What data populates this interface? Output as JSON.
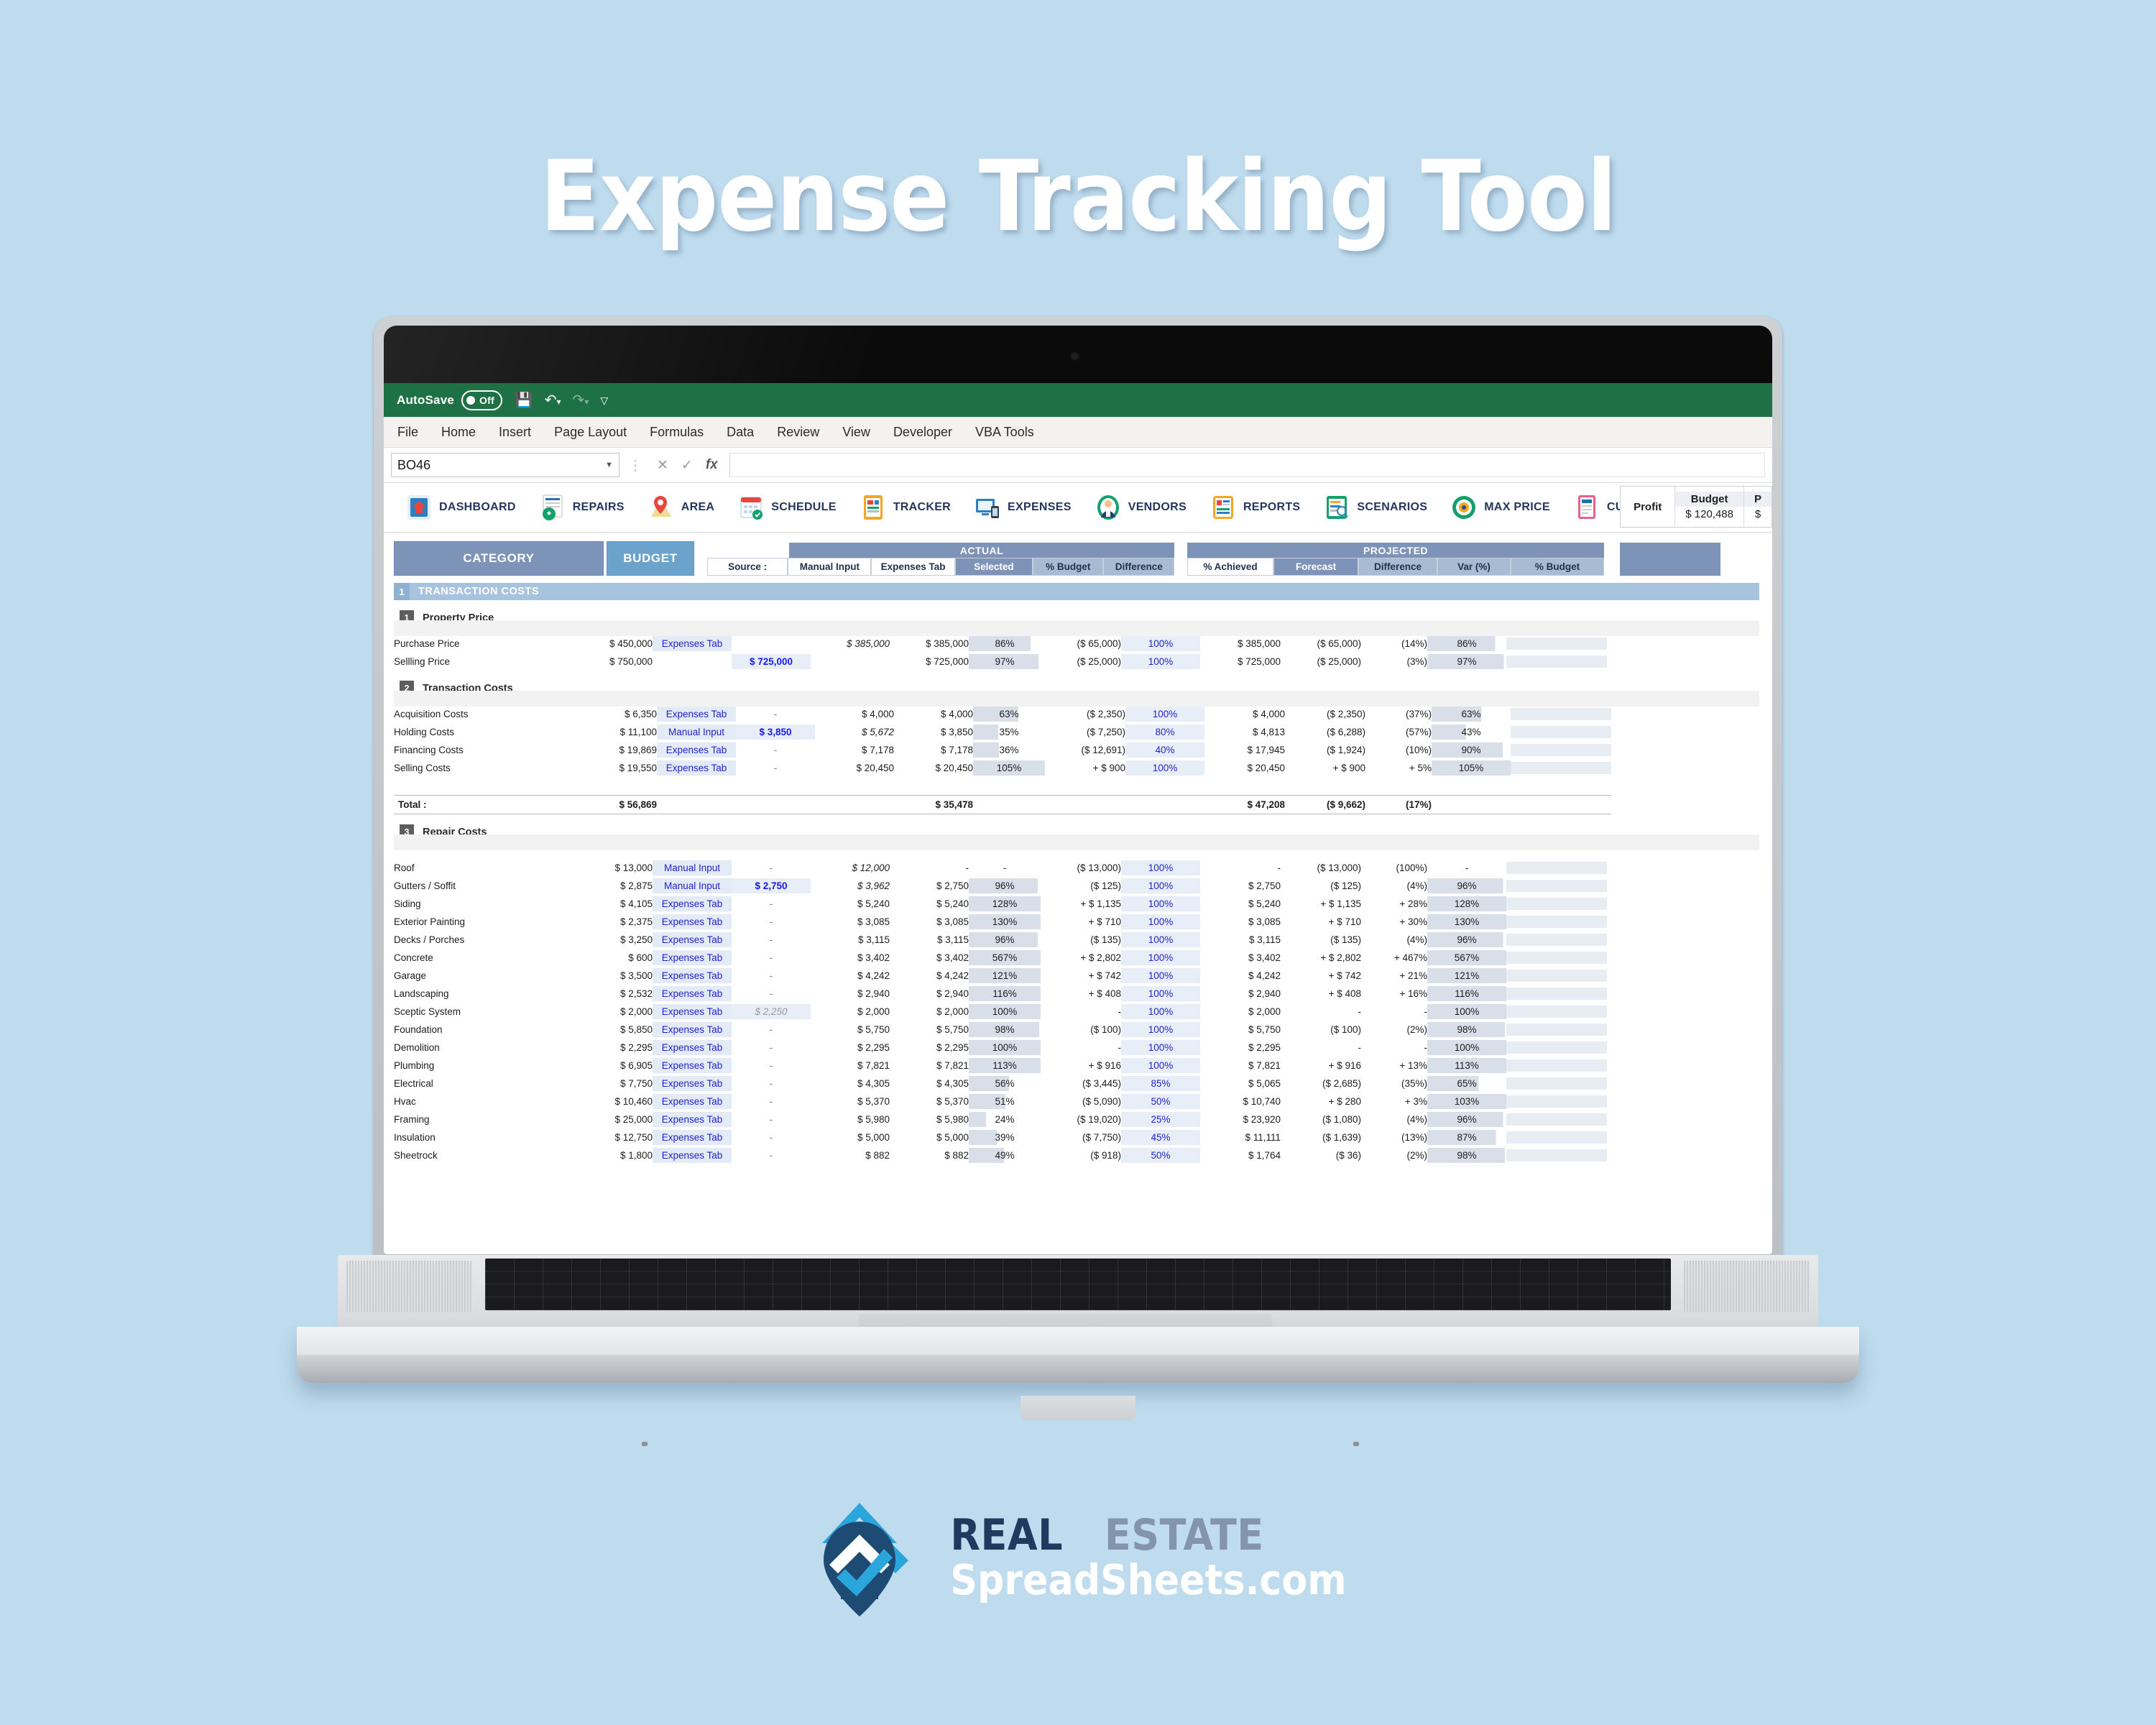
{
  "hero": {
    "title": "Expense Tracking Tool"
  },
  "excel": {
    "autosave_label": "AutoSave",
    "autosave_state": "Off",
    "quick_access": [
      "save-icon",
      "undo-icon",
      "redo-icon",
      "customize-qat-icon"
    ],
    "menu": [
      "File",
      "Home",
      "Insert",
      "Page Layout",
      "Formulas",
      "Data",
      "Review",
      "View",
      "Developer",
      "VBA Tools"
    ],
    "name_box": "BO46",
    "formula_bar": "",
    "formula_buttons": [
      "cancel-icon",
      "enter-icon",
      "insert-function-icon"
    ]
  },
  "nav": {
    "items": [
      {
        "label": "DASHBOARD",
        "icon": "dashboard-icon"
      },
      {
        "label": "REPAIRS",
        "icon": "repairs-icon"
      },
      {
        "label": "AREA",
        "icon": "area-pin-icon"
      },
      {
        "label": "SCHEDULE",
        "icon": "schedule-calendar-icon"
      },
      {
        "label": "TRACKER",
        "icon": "tracker-icon"
      },
      {
        "label": "EXPENSES",
        "icon": "expenses-icon"
      },
      {
        "label": "VENDORS",
        "icon": "vendors-icon"
      },
      {
        "label": "REPORTS",
        "icon": "reports-icon"
      },
      {
        "label": "SCENARIOS",
        "icon": "scenarios-icon"
      },
      {
        "label": "MAX PRICE",
        "icon": "max-price-icon"
      },
      {
        "label": "CUSTOM",
        "icon": "custom-icon"
      }
    ],
    "profit_box": {
      "profit_label": "Profit",
      "budget_label": "Budget",
      "budget_value": "$ 120,488",
      "next_label": "P"
    }
  },
  "table": {
    "col_category": "CATEGORY",
    "col_budget": "BUDGET",
    "group_actual": "ACTUAL",
    "group_projected": "PROJECTED",
    "actual_cols": [
      "Source :",
      "Manual Input",
      "Expenses Tab",
      "Selected",
      "% Budget",
      "Difference"
    ],
    "projected_cols": [
      "% Achieved",
      "Forecast",
      "Difference",
      "Var (%)",
      "% Budget"
    ],
    "band": {
      "num": "1",
      "title": "TRANSACTION COSTS"
    },
    "sections": [
      {
        "num": "1",
        "title": "Property Price",
        "rows": [
          {
            "name": "Purchase Price",
            "budget": "$ 450,000",
            "source": "Expenses Tab",
            "manual": "",
            "expenses": "$ 385,000",
            "expenses_style": "greyed",
            "selected": "$ 385,000",
            "pct_budget": "86%",
            "difference": "($ 65,000)",
            "difference_style": "neg",
            "achieved": "100%",
            "forecast": "$ 385,000",
            "p_difference": "($ 65,000)",
            "p_difference_style": "neg",
            "var": "(14%)",
            "var_style": "neg",
            "p_pct_budget": "86%"
          },
          {
            "name": "Sellling Price",
            "budget": "$ 750,000",
            "source": "",
            "manual": "$ 725,000",
            "expenses": "",
            "expenses_style": "",
            "selected": "$ 725,000",
            "pct_budget": "97%",
            "difference": "($ 25,000)",
            "difference_style": "pos",
            "achieved": "100%",
            "forecast": "$ 725,000",
            "p_difference": "($ 25,000)",
            "p_difference_style": "pos",
            "var": "(3%)",
            "var_style": "pos",
            "p_pct_budget": "97%"
          }
        ],
        "total": null
      },
      {
        "num": "2",
        "title": "Transaction Costs",
        "rows": [
          {
            "name": "Acquisition Costs",
            "budget": "$ 6,350",
            "source": "Expenses Tab",
            "manual": "-",
            "expenses": "$ 4,000",
            "expenses_style": "",
            "selected": "$ 4,000",
            "pct_budget": "63%",
            "difference": "($ 2,350)",
            "difference_style": "neg",
            "achieved": "100%",
            "forecast": "$ 4,000",
            "p_difference": "($ 2,350)",
            "p_difference_style": "neg",
            "var": "(37%)",
            "var_style": "neg",
            "p_pct_budget": "63%"
          },
          {
            "name": "Holding Costs",
            "budget": "$ 11,100",
            "source": "Manual Input",
            "manual": "$ 3,850",
            "expenses": "$ 5,672",
            "expenses_style": "greyed",
            "selected": "$ 3,850",
            "pct_budget": "35%",
            "difference": "($ 7,250)",
            "difference_style": "neg",
            "achieved": "80%",
            "forecast": "$ 4,813",
            "p_difference": "($ 6,288)",
            "p_difference_style": "neg",
            "var": "(57%)",
            "var_style": "neg",
            "p_pct_budget": "43%"
          },
          {
            "name": "Financing Costs",
            "budget": "$ 19,869",
            "source": "Expenses Tab",
            "manual": "-",
            "expenses": "$ 7,178",
            "expenses_style": "",
            "selected": "$ 7,178",
            "pct_budget": "36%",
            "difference": "($ 12,691)",
            "difference_style": "neg",
            "achieved": "40%",
            "forecast": "$ 17,945",
            "p_difference": "($ 1,924)",
            "p_difference_style": "neg",
            "var": "(10%)",
            "var_style": "neg",
            "p_pct_budget": "90%"
          },
          {
            "name": "Selling Costs",
            "budget": "$ 19,550",
            "source": "Expenses Tab",
            "manual": "-",
            "expenses": "$ 20,450",
            "expenses_style": "",
            "selected": "$ 20,450",
            "pct_budget": "105%",
            "difference": "+ $ 900",
            "difference_style": "pos",
            "achieved": "100%",
            "forecast": "$ 20,450",
            "p_difference": "+ $ 900",
            "p_difference_style": "pos",
            "var": "+ 5%",
            "var_style": "pos",
            "p_pct_budget": "105%"
          }
        ],
        "total": {
          "label": "Total :",
          "budget": "$ 56,869",
          "selected": "$ 35,478",
          "forecast": "$ 47,208",
          "p_difference": "($ 9,662)",
          "p_difference_style": "neg",
          "var": "(17%)",
          "var_style": "neg"
        }
      },
      {
        "num": "3",
        "title": "Repair Costs",
        "rows": [
          {
            "name": "Roof",
            "budget": "$ 13,000",
            "source": "Manual Input",
            "manual": "-",
            "expenses": "$ 12,000",
            "expenses_style": "greyed",
            "selected": "-",
            "pct_budget": "-",
            "difference": "($ 13,000)",
            "difference_style": "neg",
            "achieved": "100%",
            "forecast": "-",
            "p_difference": "($ 13,000)",
            "p_difference_style": "neg",
            "var": "(100%)",
            "var_style": "neg",
            "p_pct_budget": "-"
          },
          {
            "name": "Gutters / Soffit",
            "budget": "$ 2,875",
            "source": "Manual Input",
            "manual": "$ 2,750",
            "expenses": "$ 3,962",
            "expenses_style": "greyed",
            "selected": "$ 2,750",
            "pct_budget": "96%",
            "difference": "($ 125)",
            "difference_style": "neg",
            "achieved": "100%",
            "forecast": "$ 2,750",
            "p_difference": "($ 125)",
            "p_difference_style": "neg",
            "var": "(4%)",
            "var_style": "neg",
            "p_pct_budget": "96%"
          },
          {
            "name": "Siding",
            "budget": "$ 4,105",
            "source": "Expenses Tab",
            "manual": "-",
            "expenses": "$ 5,240",
            "expenses_style": "",
            "selected": "$ 5,240",
            "pct_budget": "128%",
            "difference": "+ $ 1,135",
            "difference_style": "pos",
            "achieved": "100%",
            "forecast": "$ 5,240",
            "p_difference": "+ $ 1,135",
            "p_difference_style": "pos",
            "var": "+ 28%",
            "var_style": "pos",
            "p_pct_budget": "128%"
          },
          {
            "name": "Exterior Painting",
            "budget": "$ 2,375",
            "source": "Expenses Tab",
            "manual": "-",
            "expenses": "$ 3,085",
            "expenses_style": "",
            "selected": "$ 3,085",
            "pct_budget": "130%",
            "difference": "+ $ 710",
            "difference_style": "pos",
            "achieved": "100%",
            "forecast": "$ 3,085",
            "p_difference": "+ $ 710",
            "p_difference_style": "pos",
            "var": "+ 30%",
            "var_style": "pos",
            "p_pct_budget": "130%"
          },
          {
            "name": "Decks / Porches",
            "budget": "$ 3,250",
            "source": "Expenses Tab",
            "manual": "-",
            "expenses": "$ 3,115",
            "expenses_style": "",
            "selected": "$ 3,115",
            "pct_budget": "96%",
            "difference": "($ 135)",
            "difference_style": "neg",
            "achieved": "100%",
            "forecast": "$ 3,115",
            "p_difference": "($ 135)",
            "p_difference_style": "neg",
            "var": "(4%)",
            "var_style": "neg",
            "p_pct_budget": "96%"
          },
          {
            "name": "Concrete",
            "budget": "$ 600",
            "source": "Expenses Tab",
            "manual": "-",
            "expenses": "$ 3,402",
            "expenses_style": "",
            "selected": "$ 3,402",
            "pct_budget": "567%",
            "difference": "+ $ 2,802",
            "difference_style": "pos",
            "achieved": "100%",
            "forecast": "$ 3,402",
            "p_difference": "+ $ 2,802",
            "p_difference_style": "pos",
            "var": "+ 467%",
            "var_style": "pos",
            "p_pct_budget": "567%"
          },
          {
            "name": "Garage",
            "budget": "$ 3,500",
            "source": "Expenses Tab",
            "manual": "-",
            "expenses": "$ 4,242",
            "expenses_style": "",
            "selected": "$ 4,242",
            "pct_budget": "121%",
            "difference": "+ $ 742",
            "difference_style": "pos",
            "achieved": "100%",
            "forecast": "$ 4,242",
            "p_difference": "+ $ 742",
            "p_difference_style": "pos",
            "var": "+ 21%",
            "var_style": "pos",
            "p_pct_budget": "121%"
          },
          {
            "name": "Landscaping",
            "budget": "$ 2,532",
            "source": "Expenses Tab",
            "manual": "-",
            "expenses": "$ 2,940",
            "expenses_style": "",
            "selected": "$ 2,940",
            "pct_budget": "116%",
            "difference": "+ $ 408",
            "difference_style": "pos",
            "achieved": "100%",
            "forecast": "$ 2,940",
            "p_difference": "+ $ 408",
            "p_difference_style": "pos",
            "var": "+ 16%",
            "var_style": "pos",
            "p_pct_budget": "116%"
          },
          {
            "name": "Sceptic System",
            "budget": "$ 2,000",
            "source": "Expenses Tab",
            "manual": "$ 2,250",
            "manual_style": "greyed",
            "expenses": "$ 2,000",
            "expenses_style": "",
            "selected": "$ 2,000",
            "pct_budget": "100%",
            "difference": "-",
            "difference_style": "dash",
            "achieved": "100%",
            "forecast": "$ 2,000",
            "p_difference": "-",
            "p_difference_style": "dash",
            "var": "-",
            "var_style": "dash",
            "p_pct_budget": "100%"
          },
          {
            "name": "Foundation",
            "budget": "$ 5,850",
            "source": "Expenses Tab",
            "manual": "-",
            "expenses": "$ 5,750",
            "expenses_style": "",
            "selected": "$ 5,750",
            "pct_budget": "98%",
            "difference": "($ 100)",
            "difference_style": "neg",
            "achieved": "100%",
            "forecast": "$ 5,750",
            "p_difference": "($ 100)",
            "p_difference_style": "neg",
            "var": "(2%)",
            "var_style": "neg",
            "p_pct_budget": "98%"
          },
          {
            "name": "Demolition",
            "budget": "$ 2,295",
            "source": "Expenses Tab",
            "manual": "-",
            "expenses": "$ 2,295",
            "expenses_style": "",
            "selected": "$ 2,295",
            "pct_budget": "100%",
            "difference": "-",
            "difference_style": "dash",
            "achieved": "100%",
            "forecast": "$ 2,295",
            "p_difference": "-",
            "p_difference_style": "dash",
            "var": "-",
            "var_style": "dash",
            "p_pct_budget": "100%"
          },
          {
            "name": "Plumbing",
            "budget": "$ 6,905",
            "source": "Expenses Tab",
            "manual": "-",
            "expenses": "$ 7,821",
            "expenses_style": "",
            "selected": "$ 7,821",
            "pct_budget": "113%",
            "difference": "+ $ 916",
            "difference_style": "pos",
            "achieved": "100%",
            "forecast": "$ 7,821",
            "p_difference": "+ $ 916",
            "p_difference_style": "pos",
            "var": "+ 13%",
            "var_style": "pos",
            "p_pct_budget": "113%"
          },
          {
            "name": "Electrical",
            "budget": "$ 7,750",
            "source": "Expenses Tab",
            "manual": "-",
            "expenses": "$ 4,305",
            "expenses_style": "",
            "selected": "$ 4,305",
            "pct_budget": "56%",
            "difference": "($ 3,445)",
            "difference_style": "neg",
            "achieved": "85%",
            "forecast": "$ 5,065",
            "p_difference": "($ 2,685)",
            "p_difference_style": "neg",
            "var": "(35%)",
            "var_style": "neg",
            "p_pct_budget": "65%"
          },
          {
            "name": "Hvac",
            "budget": "$ 10,460",
            "source": "Expenses Tab",
            "manual": "-",
            "expenses": "$ 5,370",
            "expenses_style": "",
            "selected": "$ 5,370",
            "pct_budget": "51%",
            "difference": "($ 5,090)",
            "difference_style": "neg",
            "achieved": "50%",
            "forecast": "$ 10,740",
            "p_difference": "+ $ 280",
            "p_difference_style": "pos",
            "var": "+ 3%",
            "var_style": "pos",
            "p_pct_budget": "103%"
          },
          {
            "name": "Framing",
            "budget": "$ 25,000",
            "source": "Expenses Tab",
            "manual": "-",
            "expenses": "$ 5,980",
            "expenses_style": "",
            "selected": "$ 5,980",
            "pct_budget": "24%",
            "difference": "($ 19,020)",
            "difference_style": "neg",
            "achieved": "25%",
            "forecast": "$ 23,920",
            "p_difference": "($ 1,080)",
            "p_difference_style": "neg",
            "var": "(4%)",
            "var_style": "neg",
            "p_pct_budget": "96%"
          },
          {
            "name": "Insulation",
            "budget": "$ 12,750",
            "source": "Expenses Tab",
            "manual": "-",
            "expenses": "$ 5,000",
            "expenses_style": "",
            "selected": "$ 5,000",
            "pct_budget": "39%",
            "difference": "($ 7,750)",
            "difference_style": "neg",
            "achieved": "45%",
            "forecast": "$ 11,111",
            "p_difference": "($ 1,639)",
            "p_difference_style": "neg",
            "var": "(13%)",
            "var_style": "neg",
            "p_pct_budget": "87%"
          },
          {
            "name": "Sheetrock",
            "budget": "$ 1,800",
            "source": "Expenses Tab",
            "manual": "-",
            "expenses": "$ 882",
            "expenses_style": "",
            "selected": "$ 882",
            "pct_budget": "49%",
            "difference": "($ 918)",
            "difference_style": "neg",
            "achieved": "50%",
            "forecast": "$ 1,764",
            "p_difference": "($ 36)",
            "p_difference_style": "neg",
            "var": "(2%)",
            "var_style": "neg",
            "p_pct_budget": "98%"
          }
        ],
        "total": null
      }
    ]
  },
  "footer": {
    "brand_line1_a": "REAL",
    "brand_line1_b": "ESTATE",
    "brand_line2": "SpreadSheets.com",
    "logo_icon": "house-check-pin-logo"
  },
  "colors": {
    "background": "#bfdcef",
    "excel_green": "#1e7145",
    "header_blue": "#7e93b8",
    "budget_blue": "#6ba3cd",
    "band_blue": "#a8c3dd",
    "positive_red": "#e8344e",
    "negative_green": "#2fae6a",
    "link_blue": "#2222cc",
    "brand_dark": "#1e3a5f",
    "brand_light": "#8494ab"
  }
}
